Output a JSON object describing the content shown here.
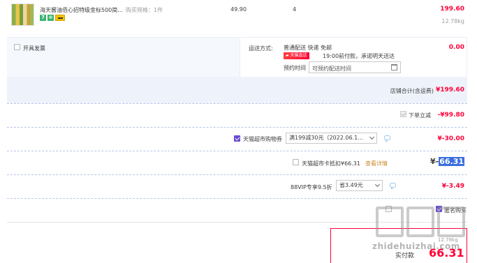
{
  "item": {
    "title": "海天酱油佰心招特级金标500简...",
    "spec": "购买规格：1件",
    "unit_price": "49.90",
    "quantity": "4",
    "subtotal": "199.60",
    "weight": "12.78kg",
    "tags": [
      "7",
      "⊕",
      "▭"
    ]
  },
  "invoice": {
    "label": "开具发票"
  },
  "shipping": {
    "label": "运送方式:",
    "method": "普通配送 快递 免邮",
    "badge": "天猫直送",
    "note": "19:00前付款，承诺明天送达",
    "time_label": "预约时间",
    "time_placeholder": "可预约配送时间",
    "fee": "0.00"
  },
  "store_total": {
    "label": "店铺合计(含运费)",
    "value": "¥199.60"
  },
  "discount": {
    "label": "下单立减",
    "value": "-¥99.80"
  },
  "coupon": {
    "label": "天猫超市购物券",
    "selected": "满199减30元（2022.06.1...",
    "value": "¥-30.00"
  },
  "card": {
    "label": "天猫超市卡抵扣¥66.31",
    "link": "查看详情",
    "value_prefix": "¥-",
    "value_highlight": "66.31"
  },
  "vip": {
    "label": "88VIP专享9.5折",
    "selected": "省3.49元",
    "value": "¥-3.49"
  },
  "bottom": {
    "anon": "匿名购买",
    "weight_partial": "12.78kg",
    "pay_label": "实付款",
    "pay_value": "66.31"
  },
  "watermark": {
    "site": "zhidehuizhai.com"
  },
  "colors": {
    "accent": "#ff0036",
    "highlight": "#3b6fde",
    "band": "#eef3fb",
    "checkbox": "#6a4bd4"
  }
}
